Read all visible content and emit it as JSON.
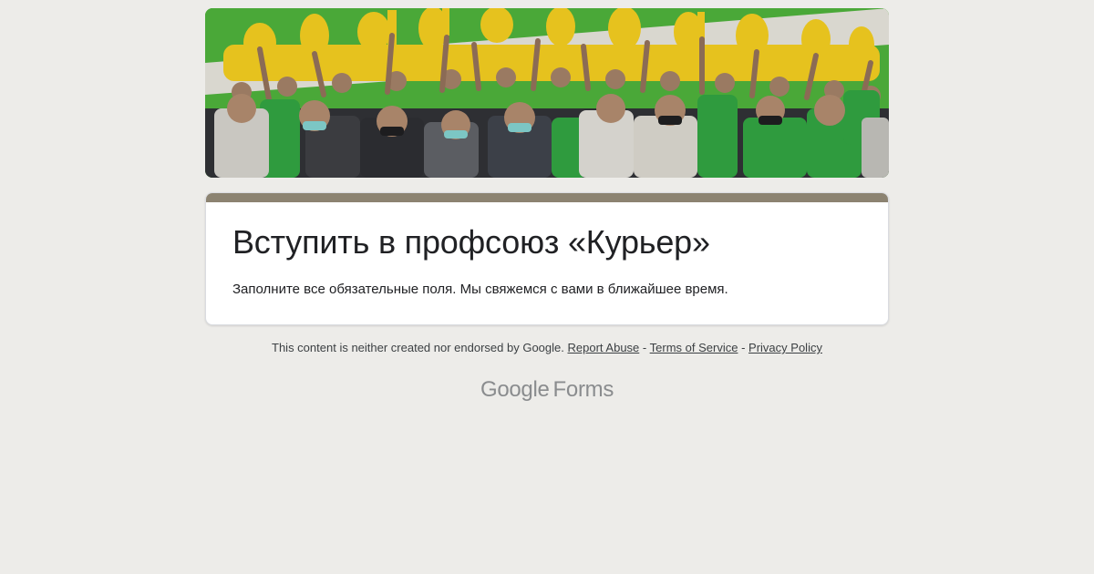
{
  "form": {
    "title": "Вступить в профсоюз «Курьер»",
    "description": "Заполните все обязательные поля. Мы свяжемся с вами в ближайшее время."
  },
  "colors": {
    "page_background": "#edece9",
    "accent_bar": "#8c8371",
    "banner_green": "#4aa838",
    "banner_yellow": "#e6c21e"
  },
  "footer": {
    "disclaimer": "This content is neither created nor endorsed by Google.",
    "report_abuse": "Report Abuse",
    "separator": "-",
    "terms": "Terms of Service",
    "privacy": "Privacy Policy"
  },
  "brand": {
    "google": "Google",
    "forms": "Forms"
  },
  "banner": {
    "icon": "crowd-photo-banner"
  }
}
